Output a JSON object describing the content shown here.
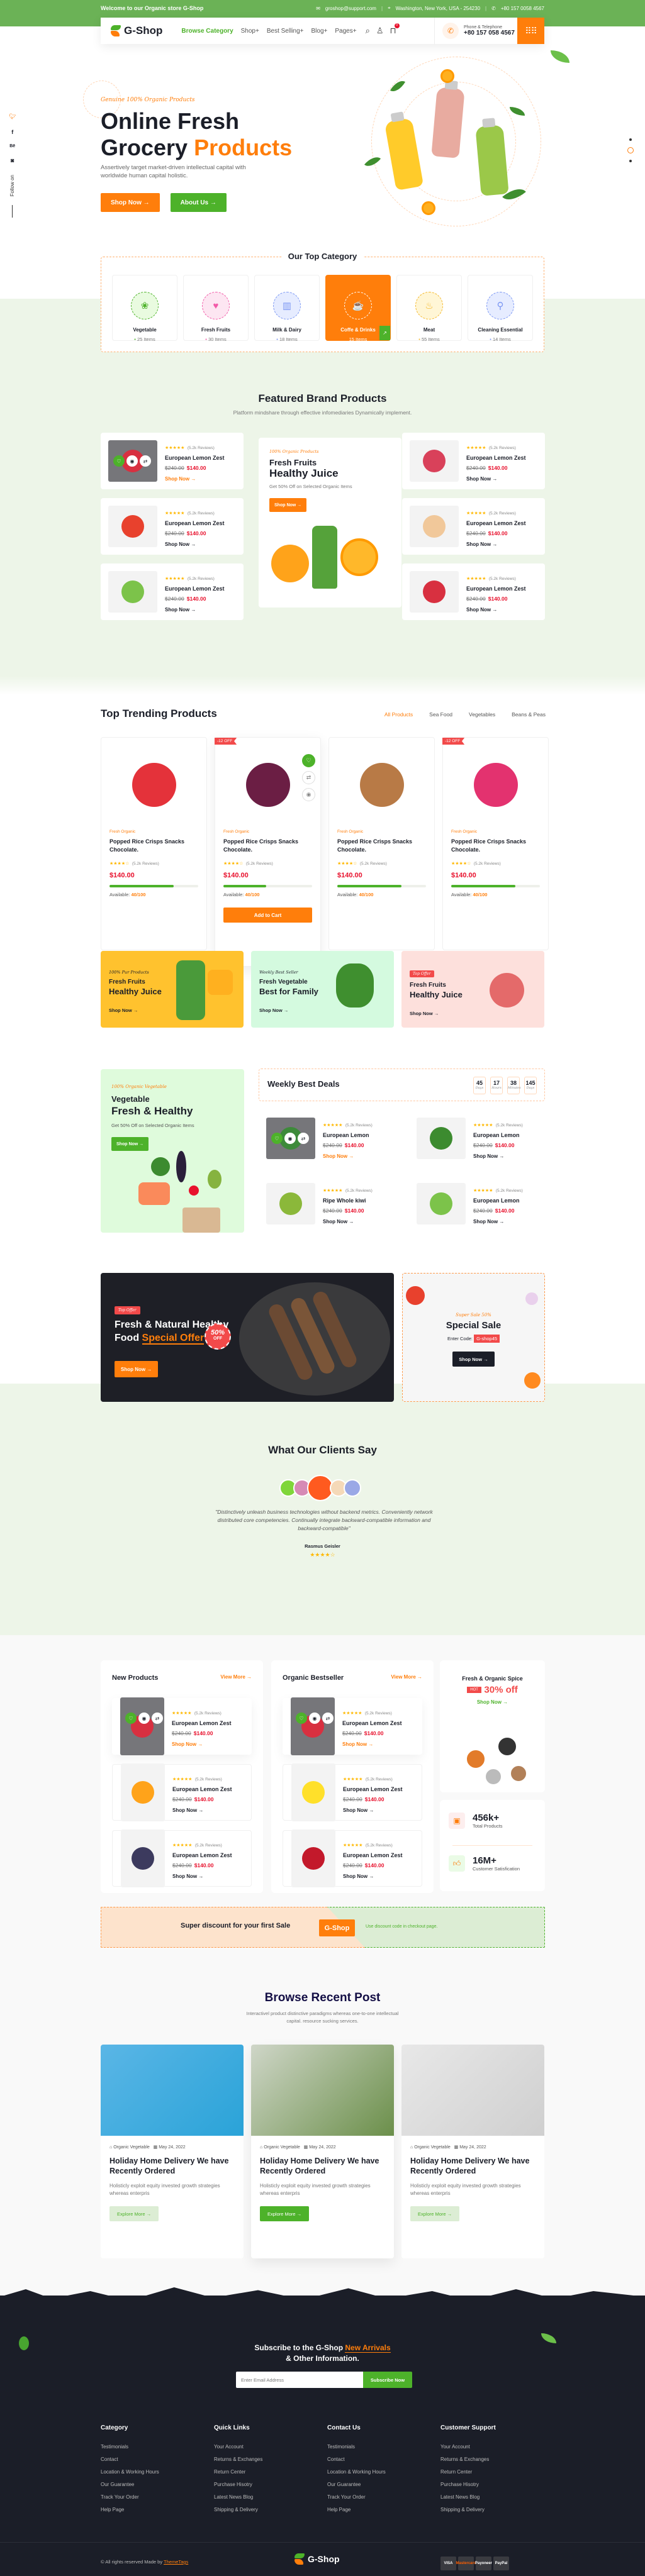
{
  "topbar": {
    "welcome": "Welcome to our Organic store G-Shop",
    "email": "groshop@support.com",
    "address": "Washington, New York, USA - 254230",
    "phone": "+80 157 0058 4567"
  },
  "header": {
    "brand": "G-Shop",
    "nav": [
      "Browse Category",
      "Shop+",
      "Best Selling+",
      "Blog+",
      "Pages+"
    ],
    "cart_count": "0",
    "phone_label": "Phone & Telephone",
    "phone_number": "+80 157 058 4567"
  },
  "social": {
    "follow_label": "Follow on",
    "icons": [
      "twitter-icon",
      "facebook-icon",
      "behance-icon",
      "discord-icon"
    ]
  },
  "hero": {
    "tagline": "Genuine 100% Organic Products",
    "title_line1": "Online Fresh",
    "title_line2_a": "Grocery",
    "title_line2_b": "Products",
    "description": "Assertively target market-driven intellectual capital with worldwide human capital holistic.",
    "primary_button": "Shop Now →",
    "secondary_button": "About Us →",
    "slide_active": 2,
    "slide_count": 3
  },
  "top_category": {
    "title": "Our Top Category",
    "items": [
      {
        "name": "Vegetable",
        "count": "25 Items",
        "icon": "broccoli-icon",
        "color": "#4db22a",
        "bg": "#e9fbe0"
      },
      {
        "name": "Fresh Fruits",
        "count": "30 Items",
        "icon": "apple-icon",
        "color": "#f25aa8",
        "bg": "#fde6f2"
      },
      {
        "name": "Milk & Dairy",
        "count": "18 Items",
        "icon": "milk-icon",
        "color": "#7b97f3",
        "bg": "#e6ecff"
      },
      {
        "name": "Coffe & Drinks",
        "count": "15 Items",
        "icon": "coffee-cup-icon",
        "color": "#ffffff",
        "bg": "#ff7e0b",
        "active": true
      },
      {
        "name": "Meat",
        "count": "55 Items",
        "icon": "drumstick-icon",
        "color": "#f5b82a",
        "bg": "#fff6d6"
      },
      {
        "name": "Cleaning Essential",
        "count": "14 Items",
        "icon": "broom-icon",
        "color": "#7b97f3",
        "bg": "#e6ecff"
      }
    ]
  },
  "featured": {
    "title": "Featured Brand Products",
    "subtitle": "Platform mindshare through effective infomediaries Dynamically implement.",
    "products": [
      {
        "name": "European Lemon Zest",
        "rating": 5,
        "reviews": "(5.2k Reviews)",
        "old_price": "$240.00",
        "price": "$140.00",
        "cta": "Shop Now →",
        "fruit": "strawberry",
        "hover": true
      },
      {
        "name": "European Lemon Zest",
        "rating": 5,
        "reviews": "(5.2k Reviews)",
        "old_price": "$240.00",
        "price": "$140.00",
        "cta": "Shop Now →",
        "fruit": "tomato"
      },
      {
        "name": "European Lemon Zest",
        "rating": 5,
        "reviews": "(5.2k Reviews)",
        "old_price": "$240.00",
        "price": "$140.00",
        "cta": "Shop Now →",
        "fruit": "lime"
      },
      {
        "name": "European Lemon Zest",
        "rating": 5,
        "reviews": "(5.2k Reviews)",
        "old_price": "$240.00",
        "price": "$140.00",
        "cta": "Shop Now →",
        "fruit": "meat"
      },
      {
        "name": "European Lemon Zest",
        "rating": 5,
        "reviews": "(5.2k Reviews)",
        "old_price": "$240.00",
        "price": "$140.00",
        "cta": "Shop Now →",
        "fruit": "chicken"
      },
      {
        "name": "European Lemon Zest",
        "rating": 5,
        "reviews": "(5.2k Reviews)",
        "old_price": "$240.00",
        "price": "$140.00",
        "cta": "Shop Now →",
        "fruit": "strawberry"
      }
    ],
    "promo": {
      "tag": "100% Organic Products",
      "line1": "Fresh Fruits",
      "line2": "Healthy Juice",
      "desc": "Get 50% Off on Selected Organic Items",
      "button": "Shop Now →"
    }
  },
  "trending": {
    "title": "Top Trending Products",
    "tabs": [
      "All Products",
      "Sea Food",
      "Vegetables",
      "Beans & Peas"
    ],
    "active_tab": 0,
    "products": [
      {
        "category": "Fresh Organic",
        "name": "Popped Rice Crisps Snacks Chocolate.",
        "rating": 4,
        "reviews": "(5.2k Reviews)",
        "price": "$140.00",
        "available_label": "Available:",
        "available": "40/100",
        "stock_fraction": 0.72,
        "badge": "",
        "fruit": "apple"
      },
      {
        "category": "Fresh Organic",
        "name": "Popped Rice Crisps Snacks Chocolate.",
        "rating": 4,
        "reviews": "(5.2k Reviews)",
        "price": "$140.00",
        "available_label": "Available:",
        "available": "40/100",
        "stock_fraction": 0.48,
        "badge": "-12 OFF",
        "fruit": "plum",
        "hover": true,
        "cta": "Add to Cart"
      },
      {
        "category": "Fresh Organic",
        "name": "Popped Rice Crisps Snacks Chocolate.",
        "rating": 4,
        "reviews": "(5.2k Reviews)",
        "price": "$140.00",
        "available_label": "Available:",
        "available": "40/100",
        "stock_fraction": 0.72,
        "badge": "",
        "fruit": "almond"
      },
      {
        "category": "Fresh Organic",
        "name": "Popped Rice Crisps Snacks Chocolate.",
        "rating": 4,
        "reviews": "(5.2k Reviews)",
        "price": "$140.00",
        "available_label": "Available:",
        "available": "40/100",
        "stock_fraction": 0.72,
        "badge": "-12 OFF",
        "fruit": "dragonfruit"
      }
    ]
  },
  "banners": [
    {
      "tag": "100% Pur Products",
      "line1": "Fresh Fruits",
      "line2": "Healthy Juice",
      "cta": "Shop Now →",
      "bg": "#ffc22e"
    },
    {
      "tag": "Weekly Best Seller",
      "line1": "Fresh Vegetable",
      "line2": "Best for Family",
      "cta": "Shop Now →",
      "bg": "#d4fadf"
    },
    {
      "tag": "Top Offer",
      "line1": "Fresh Fruits",
      "line2": "Healthy Juice",
      "cta": "Shop Now →",
      "bg": "#fde0dc"
    }
  ],
  "veg_promo": {
    "tag": "100% Organic Vegetable",
    "line1": "Vegetable",
    "line2": "Fresh & Healthy",
    "desc": "Get 50% Off on Selected Organic Items",
    "button": "Shop Now →"
  },
  "weekly_deals": {
    "title": "Weekly Best  Deals",
    "timer": [
      {
        "value": "45",
        "unit": "Days"
      },
      {
        "value": "17",
        "unit": "Hours"
      },
      {
        "value": "38",
        "unit": "Minutes"
      },
      {
        "value": "145",
        "unit": "Days"
      }
    ],
    "products": [
      {
        "name": "European Lemon",
        "rating": 5,
        "reviews": "(5.2k Reviews)",
        "old_price": "$240.00",
        "price": "$140.00",
        "cta": "Shop Now →",
        "fruit": "juice",
        "hover": true
      },
      {
        "name": "European Lemon",
        "rating": 5,
        "reviews": "(5.2k Reviews)",
        "old_price": "$240.00",
        "price": "$140.00",
        "cta": "Shop Now →",
        "fruit": "broccoli"
      },
      {
        "name": "Ripe Whole kiwi",
        "rating": 5,
        "reviews": "(5.2k Reviews)",
        "old_price": "$240.00",
        "price": "$140.00",
        "cta": "Shop Now →",
        "fruit": "kiwi"
      },
      {
        "name": "European Lemon",
        "rating": 5,
        "reviews": "(5.2k Reviews)",
        "old_price": "$240.00",
        "price": "$140.00",
        "cta": "Shop Now →",
        "fruit": "lime"
      }
    ]
  },
  "special_offer": {
    "pill": "Top Offer",
    "line1": "Fresh & Natural Healthy",
    "line2_a": "Food",
    "line2_b": "Special Offer",
    "discount": "50%",
    "discount_sub": "OFF",
    "button": "Shop Now →"
  },
  "special_sale": {
    "tag": "Super Sale 50%",
    "title": "Special Sale",
    "code_label": "Enter Code:",
    "code": "G-shop45",
    "button": "Shop Now →"
  },
  "testimonial": {
    "title": "What Our Clients Say",
    "quote": "\"Distinctively unleash business technologies without backend metrics. Conveniently network distributed core competencies. Continually integrate backward-compatible information and backward-compatible\"",
    "author": "Rasmus Geisler",
    "rating": 4
  },
  "new_products": {
    "title": "New Products",
    "view_more": "View More →",
    "items": [
      {
        "name": "European Lemon Zest",
        "rating": 5,
        "reviews": "(5.2k Reviews)",
        "old_price": "$240.00",
        "price": "$140.00",
        "cta": "Shop Now →",
        "fruit": "strawberry",
        "hover": true
      },
      {
        "name": "European Lemon Zest",
        "rating": 5,
        "reviews": "(5.2k Reviews)",
        "old_price": "$240.00",
        "price": "$140.00",
        "cta": "Shop Now →",
        "fruit": "orange"
      },
      {
        "name": "European Lemon Zest",
        "rating": 5,
        "reviews": "(5.2k Reviews)",
        "old_price": "$240.00",
        "price": "$140.00",
        "cta": "Shop Now →",
        "fruit": "grape"
      }
    ]
  },
  "organic_bestseller": {
    "title": "Organic Bestseller",
    "view_more": "View More →",
    "items": [
      {
        "name": "European Lemon Zest",
        "rating": 5,
        "reviews": "(5.2k Reviews)",
        "old_price": "$240.00",
        "price": "$140.00",
        "cta": "Shop Now →",
        "fruit": "strawberry",
        "hover": true
      },
      {
        "name": "European Lemon Zest",
        "rating": 5,
        "reviews": "(5.2k Reviews)",
        "old_price": "$240.00",
        "price": "$140.00",
        "cta": "Shop Now →",
        "fruit": "lemon"
      },
      {
        "name": "European Lemon Zest",
        "rating": 5,
        "reviews": "(5.2k Reviews)",
        "old_price": "$240.00",
        "price": "$140.00",
        "cta": "Shop Now →",
        "fruit": "pomegranate"
      }
    ]
  },
  "spice_promo": {
    "title": "Fresh & Organic Spice",
    "hot": "HOT",
    "discount": "30% off",
    "cta": "Shop Now →"
  },
  "stats": [
    {
      "value": "456k+",
      "label": "Total Products",
      "icon": "box-icon"
    },
    {
      "value": "16M+",
      "label": "Customer Satisfication",
      "icon": "thumbs-up-icon"
    }
  ],
  "discount_strip": {
    "text": "Super discount for your first Sale",
    "code": "G-Shop",
    "note": "Use discount code in checkout page."
  },
  "blog": {
    "title": "Browse Recent Post",
    "subtitle": "Interactivel product distinctive paradigms whereas one-to-one intellectual capital. resource sucking services.",
    "posts": [
      {
        "category": "Organic Vegetable",
        "date": "May 24, 2022",
        "title": "Holiday Home Delivery We have Recently Ordered",
        "excerpt": "Holisticly exploit equity invested growth strategies whereas enterpris",
        "cta": "Explore More →"
      },
      {
        "category": "Organic Vegetable",
        "date": "May 24, 2022",
        "title": "Holiday Home Delivery We have Recently Ordered",
        "excerpt": "Holisticly exploit equity invested growth strategies whereas enterpris",
        "cta": "Explore More →",
        "active": true
      },
      {
        "category": "Organic Vegetable",
        "date": "May 24, 2022",
        "title": "Holiday Home Delivery We have Recently Ordered",
        "excerpt": "Holisticly exploit equity invested growth strategies whereas enterpris",
        "cta": "Explore More →"
      }
    ]
  },
  "subscribe": {
    "title_a": "Subscribe to the G-Shop",
    "title_b": "New Arrivals",
    "title_c": "& Other Information.",
    "placeholder": "Enter Email Address",
    "button": "Subscribe Now"
  },
  "footer": {
    "columns": [
      {
        "title": "Category",
        "links": [
          "Testimonials",
          "Contact",
          "Location & Working Hours",
          "Our Guarantee",
          "Track Your Order",
          "Help Page"
        ]
      },
      {
        "title": "Quick Links",
        "links": [
          "Your Account",
          "Returns & Exchanges",
          "Return Center",
          "Purchase Hisotry",
          "Latest News Blog",
          "Shipping & Delivery"
        ]
      },
      {
        "title": "Contact Us",
        "links": [
          "Testimonials",
          "Contact",
          "Location & Working Hours",
          "Our Guarantee",
          "Track Your Order",
          "Help Page"
        ]
      },
      {
        "title": "Customer Support",
        "links": [
          "Your Account",
          "Returns & Exchanges",
          "Return Center",
          "Purchase Hisotry",
          "Latest News Blog",
          "Shipping & Delivery"
        ]
      }
    ],
    "copyright": "© All rights reserved Made by",
    "credit": "ThemeTags",
    "brand": "G-Shop",
    "payments": [
      "VISA",
      "Mastercard",
      "Payoneer",
      "PayPal"
    ]
  },
  "colors": {
    "primary_green": "#4db22a",
    "topbar_green": "#6bb256",
    "accent_orange": "#ff7e0b",
    "price_red": "#e8112d",
    "dark": "#1b1e28",
    "soft_green_bg": "#edf5e8"
  }
}
